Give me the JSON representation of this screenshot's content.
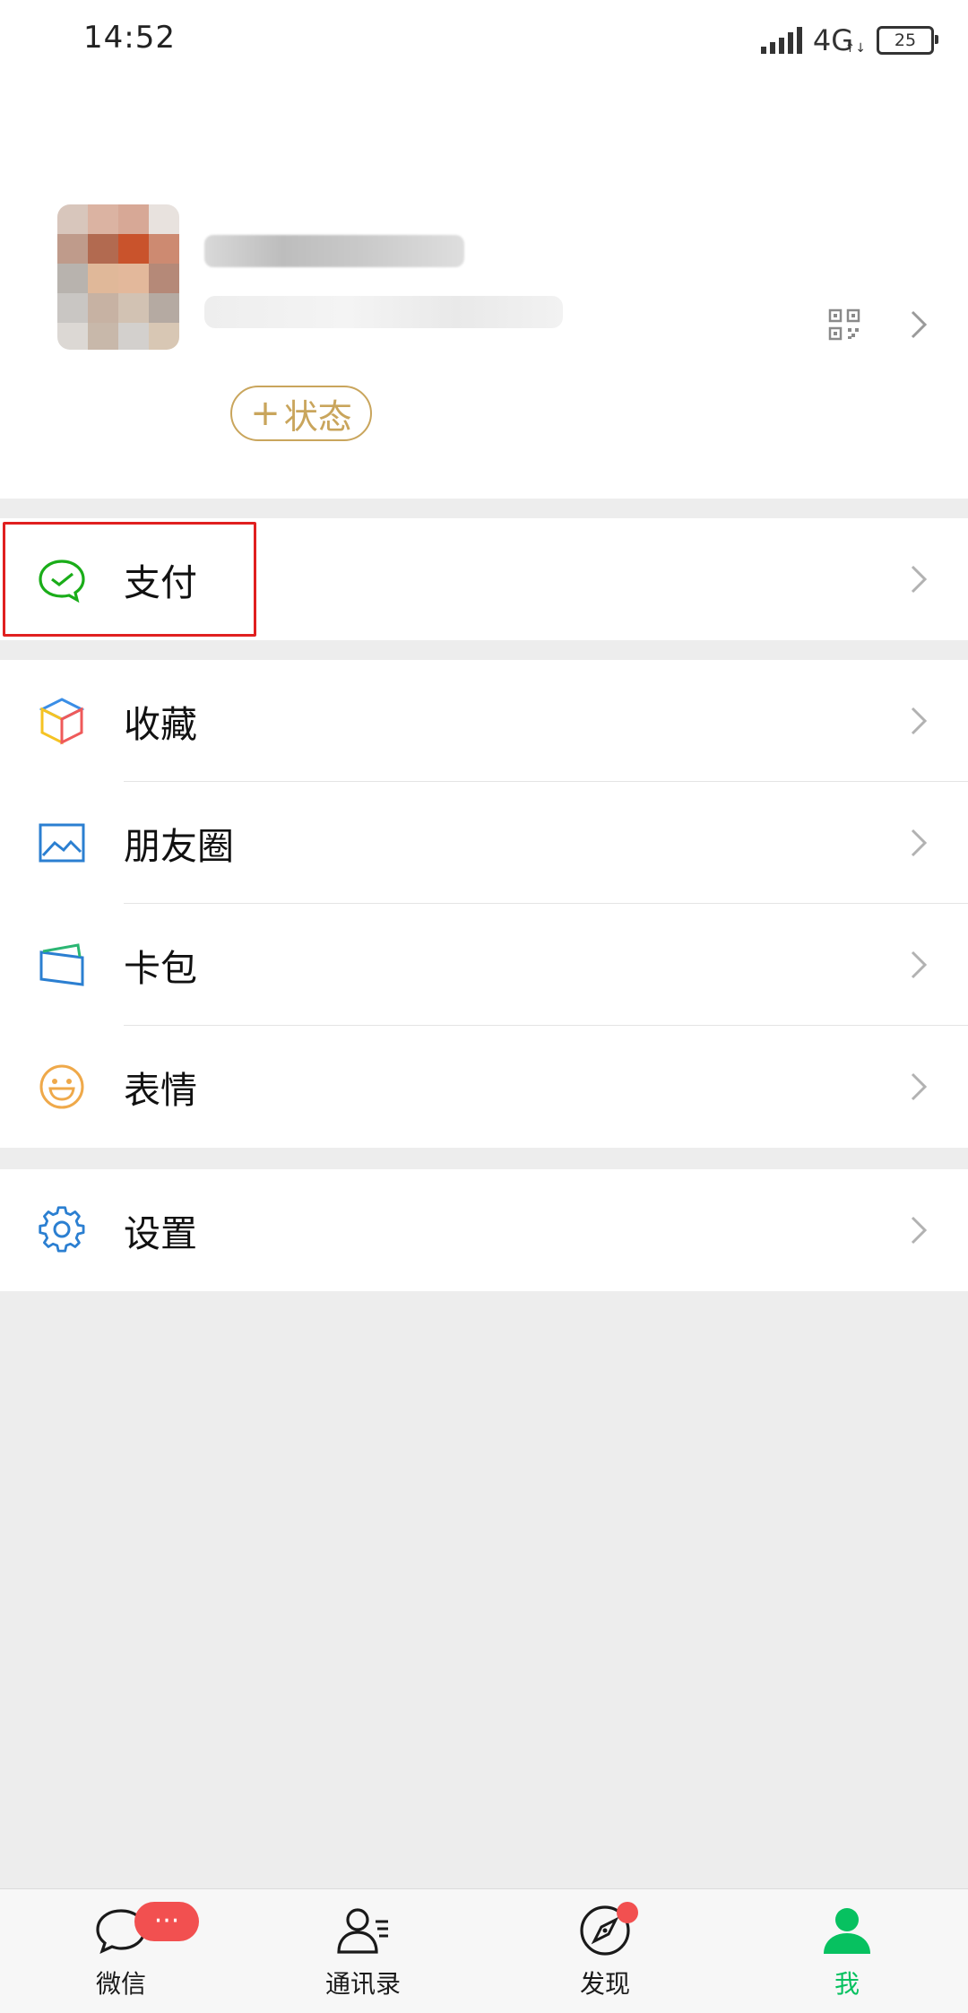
{
  "status_bar": {
    "time": "14:52",
    "network": "4G",
    "network_sub": "↑↓",
    "battery": "25"
  },
  "profile": {
    "status_label": "状态",
    "status_plus": "+"
  },
  "menu": {
    "pay": "支付",
    "favorites": "收藏",
    "moments": "朋友圈",
    "cards": "卡包",
    "stickers": "表情",
    "settings": "设置"
  },
  "tabs": [
    {
      "label": "微信",
      "icon": "chat-icon",
      "badge": "···"
    },
    {
      "label": "通讯录",
      "icon": "contacts-icon"
    },
    {
      "label": "发现",
      "icon": "compass-icon"
    },
    {
      "label": "我",
      "icon": "person-icon",
      "active": true
    }
  ],
  "colors": {
    "accent": "#07c160",
    "badge": "#f25050",
    "status_gold": "#c9a55c",
    "highlight": "#e02020"
  }
}
